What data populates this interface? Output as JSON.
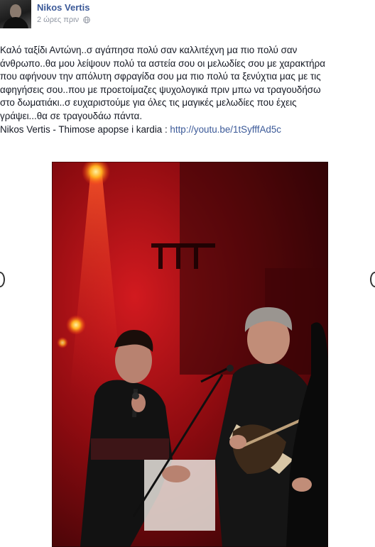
{
  "post": {
    "author": "Nikos Vertis",
    "time": "2 ώρες πριν",
    "text_lines": [
      "Καλό ταξίδι Αντώνη..σ αγάπησα πολύ σαν καλλιτέχνη μα πιο πολύ σαν",
      "άνθρωπο..θα μου λείψουν πολύ τα αστεία σου οι μελωδίες σου με χαρακτήρα",
      "που αφήνουν την απόλυτη σφραγίδα σου μα πιο πολύ τα ξενύχτια μας με τις",
      "αφηγήσεις σου..που με προετοίμαζες ψυχολογικά πριν μπω να τραγουδήσω",
      "στο δωματιάκι..σ ευχαριστούμε για όλες τις μαγικές μελωδίες που έχεις",
      "γράψει...θα σε τραγουδάω πάντα."
    ],
    "link_prefix": "Nikos Vertis - Thimose apopse i kardia : ",
    "link_url": "http://youtu.be/1tSyfffAd5c"
  },
  "icons": {
    "privacy": "globe-icon",
    "prev": "chevron-left-icon",
    "next": "chevron-right-icon"
  },
  "colors": {
    "link": "#3b5998",
    "meta": "#9197a3",
    "text": "#141823",
    "stage_red": "#c8141c"
  }
}
